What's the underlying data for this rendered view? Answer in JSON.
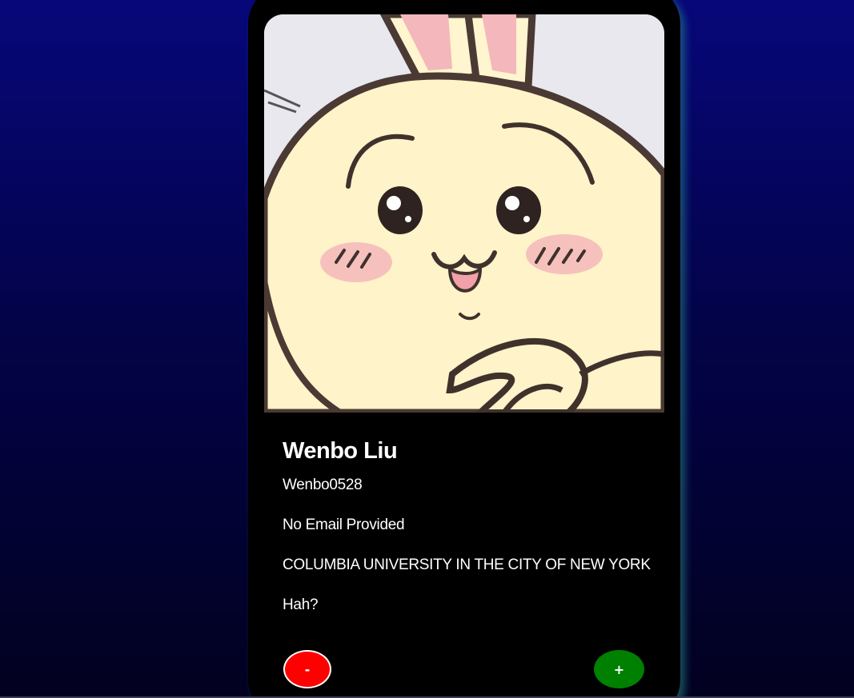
{
  "profile": {
    "name": "Wenbo Liu",
    "username": "Wenbo0528",
    "email": "No Email Provided",
    "school": "COLUMBIA UNIVERSITY IN THE CITY OF NEW YORK",
    "bio": "Hah?"
  },
  "actions": {
    "decrease_label": "-",
    "increase_label": "+"
  },
  "colors": {
    "background_top": "#07077a",
    "background_bottom": "#020120",
    "card": "#000000",
    "decrease_button": "#ff0000",
    "increase_button": "#008000"
  }
}
